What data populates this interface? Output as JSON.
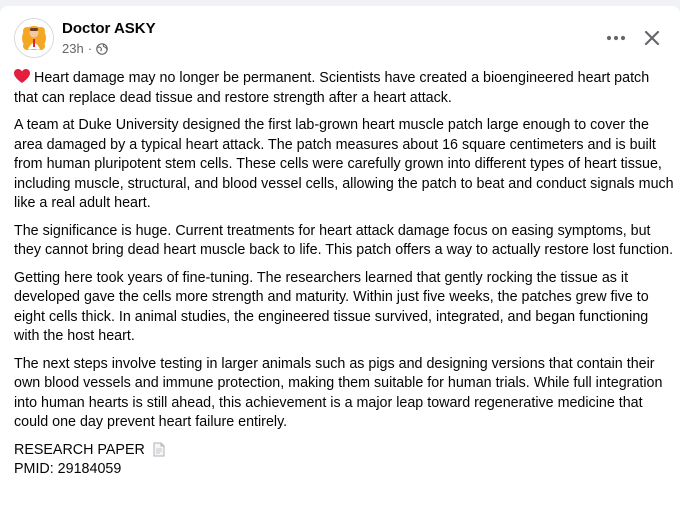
{
  "post": {
    "author": "Doctor ASKY",
    "time": "23h",
    "separator": "·",
    "avatar_icon": "doctor-avatar-icon",
    "heart_icon": "red-heart-emoji",
    "doc_icon": "page-document-icon",
    "accent_color": "#e41e3f",
    "paragraphs": [
      "Heart damage may no longer be permanent. Scientists have created a bioengineered heart patch that can replace dead tissue and restore strength after a heart attack.",
      "A team at Duke University designed the first lab-grown heart muscle patch large enough to cover the area damaged by a typical heart attack. The patch measures about 16 square centimeters and is built from human pluripotent stem cells. These cells were carefully grown into different types of heart tissue, including muscle, structural, and blood vessel cells, allowing the patch to beat and conduct signals much like a real adult heart.",
      "The significance is huge. Current treatments for heart attack damage focus on easing symptoms, but they cannot bring dead heart muscle back to life. This patch offers a way to actually restore lost function.",
      "Getting here took years of fine-tuning. The researchers learned that gently rocking the tissue as it developed gave the cells more strength and maturity. Within just five weeks, the patches grew five to eight cells thick. In animal studies, the engineered tissue survived, integrated, and began functioning with the host heart.",
      "The next steps involve testing in larger animals such as pigs and designing versions that contain their own blood vessels and immune protection, making them suitable for human trials. While full integration into human hearts is still ahead, this achievement is a major leap toward regenerative medicine that could one day prevent heart failure entirely."
    ],
    "research_label": "RESEARCH PAPER",
    "pmid_label": "PMID: 29184059"
  }
}
